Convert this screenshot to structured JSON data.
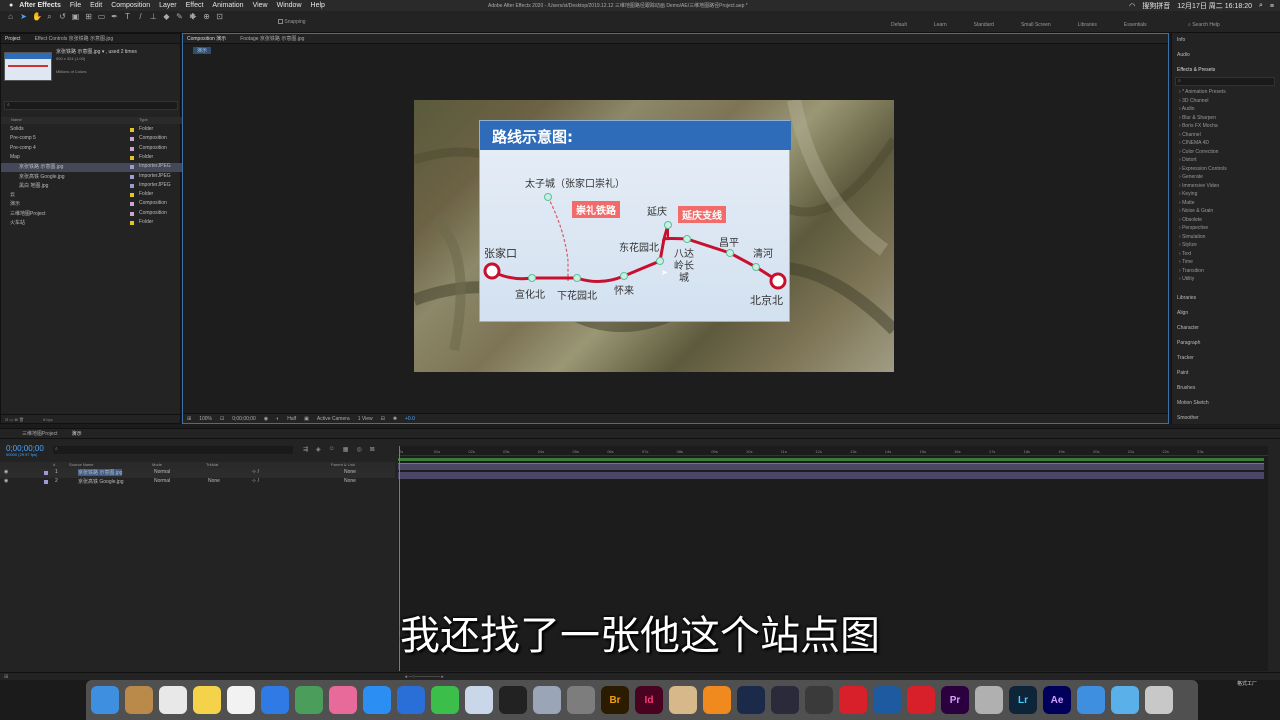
{
  "menubar": {
    "apple": "",
    "app": "After Effects",
    "items": [
      "File",
      "Edit",
      "Composition",
      "Layer",
      "Effect",
      "Animation",
      "View",
      "Window",
      "Help"
    ],
    "window_title": "Adobe After Effects 2020 - /Users/st/Desktop/2019.12.12 三维地图路径跟踪动画 Demo/AE/三维地图路径Project.aep *",
    "ime": "搜狗拼音",
    "datetime": "12月17日 周二  16:18:20"
  },
  "toolbar": {
    "snapping": "Snapping",
    "workspaces": [
      "Default",
      "Learn",
      "Standard",
      "Small Screen",
      "Libraries",
      "Essentials"
    ],
    "search_help": "Search Help"
  },
  "project_panel": {
    "tabs": [
      "Project",
      "Effect Controls 京张铁路 示意图.jpg"
    ],
    "thumb_name": "京张铁路 示意图.jpg ▾ , used 2 times",
    "thumb_size": "500 x 324 (1.00)",
    "thumb_colors": "Millions of Colors",
    "columns": [
      "Name",
      "Type"
    ],
    "items": [
      {
        "name": "Solids",
        "type": "Folder",
        "color": "#e5c42a",
        "indent": 0
      },
      {
        "name": "Pre-comp 5",
        "type": "Composition",
        "color": "#c7a6d0",
        "indent": 0
      },
      {
        "name": "Pre-comp 4",
        "type": "Composition",
        "color": "#c7a6d0",
        "indent": 0
      },
      {
        "name": "Map",
        "type": "Folder",
        "color": "#e5c42a",
        "indent": 0
      },
      {
        "name": "京张铁路 示意图.jpg",
        "type": "ImporterJPEG",
        "color": "#9b9bd6",
        "indent": 1,
        "selected": true
      },
      {
        "name": "京张高铁 Google.jpg",
        "type": "ImporterJPEG",
        "color": "#9b9bd6",
        "indent": 1
      },
      {
        "name": "黑白 地图.jpg",
        "type": "ImporterJPEG",
        "color": "#9b9bd6",
        "indent": 1
      },
      {
        "name": "云",
        "type": "Folder",
        "color": "#e5c42a",
        "indent": 0
      },
      {
        "name": "演示",
        "type": "Composition",
        "color": "#c7a6d0",
        "indent": 0
      },
      {
        "name": "三维地图Project",
        "type": "Composition",
        "color": "#c7a6d0",
        "indent": 0
      },
      {
        "name": "火车站",
        "type": "Folder",
        "color": "#e5c42a",
        "indent": 0
      }
    ],
    "bpc": "8 bpc"
  },
  "viewer": {
    "tabs": [
      "Composition 演示",
      "Footage 京张铁路 示意图.jpg"
    ],
    "breadcrumb": "演示",
    "zoom": "100%",
    "timecode": "0;00;00;00",
    "resolution": "Half",
    "camera": "Active Camera",
    "views": "1 View",
    "exposure": "+0.0"
  },
  "route_map": {
    "title": "路线示意图:",
    "stations": [
      {
        "name": "太子城（张家口崇礼）"
      },
      {
        "name": "张家口"
      },
      {
        "name": "宣化北"
      },
      {
        "name": "下花园北"
      },
      {
        "name": "怀来"
      },
      {
        "name": "东花园北"
      },
      {
        "name": "延庆"
      },
      {
        "name": "八达岭长城"
      },
      {
        "name": "昌平"
      },
      {
        "name": "清河"
      },
      {
        "name": "北京北"
      }
    ],
    "tags": [
      "崇礼铁路",
      "延庆支线"
    ]
  },
  "right_panel": {
    "info": "Info",
    "audio": "Audio",
    "effects_title": "Effects & Presets",
    "effects": [
      "* Animation Presets",
      "3D Channel",
      "Audio",
      "Blur & Sharpen",
      "Boris FX Mocha",
      "Channel",
      "CINEMA 4D",
      "Color Correction",
      "Distort",
      "Expression Controls",
      "Generate",
      "Immersive Video",
      "Keying",
      "Matte",
      "Noise & Grain",
      "Obsolete",
      "Perspective",
      "Simulation",
      "Stylize",
      "Text",
      "Time",
      "Transition",
      "Utility"
    ],
    "panels": [
      "Libraries",
      "Align",
      "Character",
      "Paragraph",
      "Tracker",
      "Paint",
      "Brushes",
      "Motion Sketch",
      "Smoother"
    ]
  },
  "timeline": {
    "tabs": [
      "三维地图Project",
      "演示"
    ],
    "timecode": "0;00;00;00",
    "fps": "00000 (29.97 fps)",
    "columns": [
      "#",
      "Source Name",
      "Mode",
      "TrkMat",
      "Parent & Link"
    ],
    "layers": [
      {
        "num": "1",
        "name": "京张铁路 示意图.jpg",
        "mode": "Normal",
        "trkmat": "",
        "parent": "None"
      },
      {
        "num": "2",
        "name": "京张高铁 Google.jpg",
        "mode": "Normal",
        "trkmat": "None",
        "parent": "None"
      }
    ],
    "ruler": [
      "0s",
      "01s",
      "02s",
      "03s",
      "04s",
      "05s",
      "06s",
      "07s",
      "08s",
      "09s",
      "10s",
      "11s",
      "12s",
      "13s",
      "14s",
      "15s",
      "16s",
      "17s",
      "18s",
      "19s",
      "20s",
      "21s",
      "22s",
      "23s"
    ]
  },
  "subtitle": "我还找了一张他这个站点图",
  "dock": [
    "Finder",
    "Notes",
    "Calendar",
    "Stickies",
    "Reminders",
    "Baidu",
    "Chrome",
    "Photos",
    "App Store",
    "Keynote",
    "WeChat",
    "Preview",
    "QQ",
    "Launchpad",
    "Settings",
    "Br",
    "Id",
    "Archive",
    "VLC",
    "Cat",
    "Screen",
    "FCP",
    "NetEase",
    "Network",
    "CC",
    "Pr",
    "Pro",
    "Lr",
    "Ae",
    "Safari",
    "Folder",
    "Trash"
  ],
  "corner_label": "格式工厂"
}
